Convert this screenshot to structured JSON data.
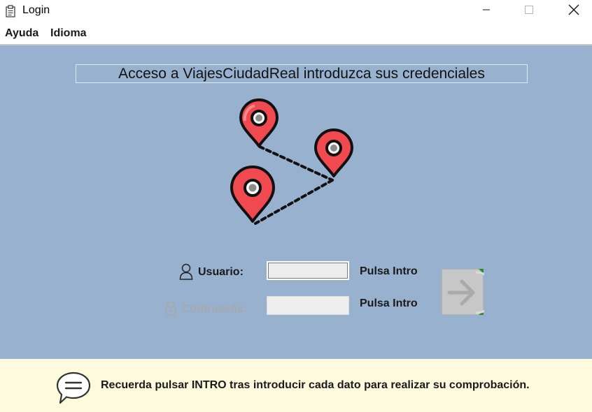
{
  "window": {
    "title": "Login",
    "app_icon": "clipboard-icon",
    "controls": {
      "minimize": "minimize-icon",
      "maximize": "maximize-icon",
      "close": "close-icon"
    }
  },
  "menu": {
    "items": [
      {
        "label": "Ayuda"
      },
      {
        "label": "Idioma"
      }
    ]
  },
  "main": {
    "background": "#98b1cf",
    "heading": "Acceso a ViajesCiudadReal introduzca sus credenciales",
    "illustration": "map-pins-route-icon",
    "pin_color": "#f0494f"
  },
  "form": {
    "user": {
      "label": "Usuario:",
      "value": "",
      "hint": "Pulsa Intro",
      "icon": "user-icon"
    },
    "password": {
      "label": "Contraseña:",
      "value": "",
      "hint": "Pulsa Intro",
      "icon": "lock-icon",
      "enabled": false
    },
    "submit_icon": "arrow-right-icon"
  },
  "footer": {
    "icon": "speech-bubble-icon",
    "message": "Recuerda pulsar INTRO tras introducir cada dato para realizar su comprobación."
  }
}
